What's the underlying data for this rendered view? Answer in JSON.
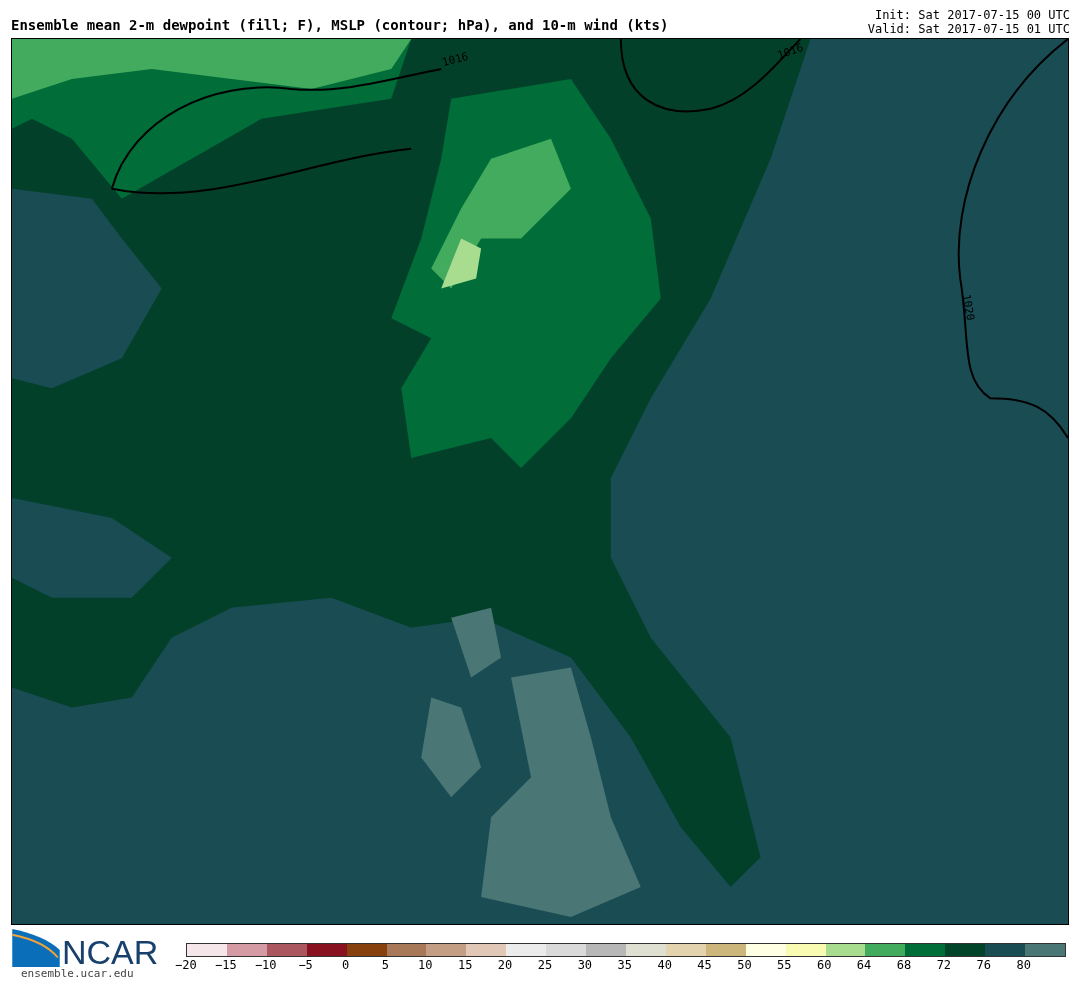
{
  "title": "Ensemble mean 2-m dewpoint (fill; F), MSLP (contour; hPa), and 10-m wind (kts)",
  "init": "Init: Sat 2017-07-15 00 UTC",
  "valid": "Valid: Sat 2017-07-15 01 UTC",
  "map": {
    "contour_labels": [
      "1016",
      "1016",
      "1020"
    ]
  },
  "logo": {
    "text": "NCAR",
    "url": "ensemble.ucar.edu"
  },
  "colorbar": [
    {
      "label": "−20",
      "color": "#f5e6ea"
    },
    {
      "label": "−15",
      "color": "#d49ba5"
    },
    {
      "label": "−10",
      "color": "#ab5760"
    },
    {
      "label": "−5",
      "color": "#88121f"
    },
    {
      "label": "0",
      "color": "#86410f"
    },
    {
      "label": "5",
      "color": "#a87958"
    },
    {
      "label": "10",
      "color": "#c49e84"
    },
    {
      "label": "15",
      "color": "#e0c7b6"
    },
    {
      "label": "20",
      "color": "#ececec"
    },
    {
      "label": "25",
      "color": "#dadada"
    },
    {
      "label": "30",
      "color": "#b7b7b7"
    },
    {
      "label": "35",
      "color": "#e0e0d2"
    },
    {
      "label": "40",
      "color": "#e3d3af"
    },
    {
      "label": "45",
      "color": "#ccb67b"
    },
    {
      "label": "50",
      "color": "#ffffe4"
    },
    {
      "label": "55",
      "color": "#f8fbb1"
    },
    {
      "label": "60",
      "color": "#a8dd8f"
    },
    {
      "label": "64",
      "color": "#42ab5d"
    },
    {
      "label": "68",
      "color": "#016d39"
    },
    {
      "label": "72",
      "color": "#024429"
    },
    {
      "label": "76",
      "color": "#1a4c54"
    },
    {
      "label": "80",
      "color": "#4a7676"
    }
  ]
}
